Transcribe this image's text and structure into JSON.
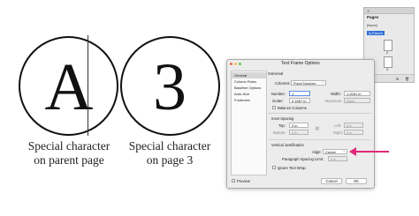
{
  "illustration": {
    "left_char": "A",
    "right_char": "3",
    "left_caption_line1": "Special character",
    "left_caption_line2": "on parent page",
    "right_caption_line1": "Special character",
    "right_caption_line2": "on page 3"
  },
  "pages_panel": {
    "title": "Pages",
    "items": [
      "[None]",
      "A-Parent"
    ],
    "page_numbers": [
      "2",
      "3"
    ]
  },
  "dialog": {
    "title": "Text Frame Options",
    "sidebar": [
      "General",
      "Column Rules",
      "Baseline Options",
      "Auto-Size",
      "Footnotes"
    ],
    "section_title": "General",
    "columns_label": "Columns:",
    "columns_value": "Fixed Number",
    "number_label": "Number:",
    "number_value": "1",
    "width_label": "Width:",
    "width_value": "1.2061 in",
    "gutter_label": "Gutter:",
    "gutter_value": "0.1667 in",
    "maximum_label": "Maximum:",
    "maximum_value": "None",
    "balance_label": "Balance Columns",
    "inset_title": "Inset Spacing",
    "top_label": "Top:",
    "top_value": "0 in",
    "bottom_label": "Bottom:",
    "bottom_value": "0 in",
    "left_label": "Left:",
    "left_value": "0 in",
    "right_label": "Right:",
    "right_value": "0 in",
    "vj_title": "Vertical Justification",
    "align_label": "Align:",
    "align_value": "Center",
    "psl_label": "Paragraph Spacing Limit:",
    "psl_value": "0 in",
    "ignore_wrap_label": "Ignore Text Wrap",
    "preview_label": "Preview",
    "cancel_label": "Cancel",
    "ok_label": "OK"
  },
  "colors": {
    "arrow": "#e0297a",
    "selection": "#2f6fd6"
  }
}
